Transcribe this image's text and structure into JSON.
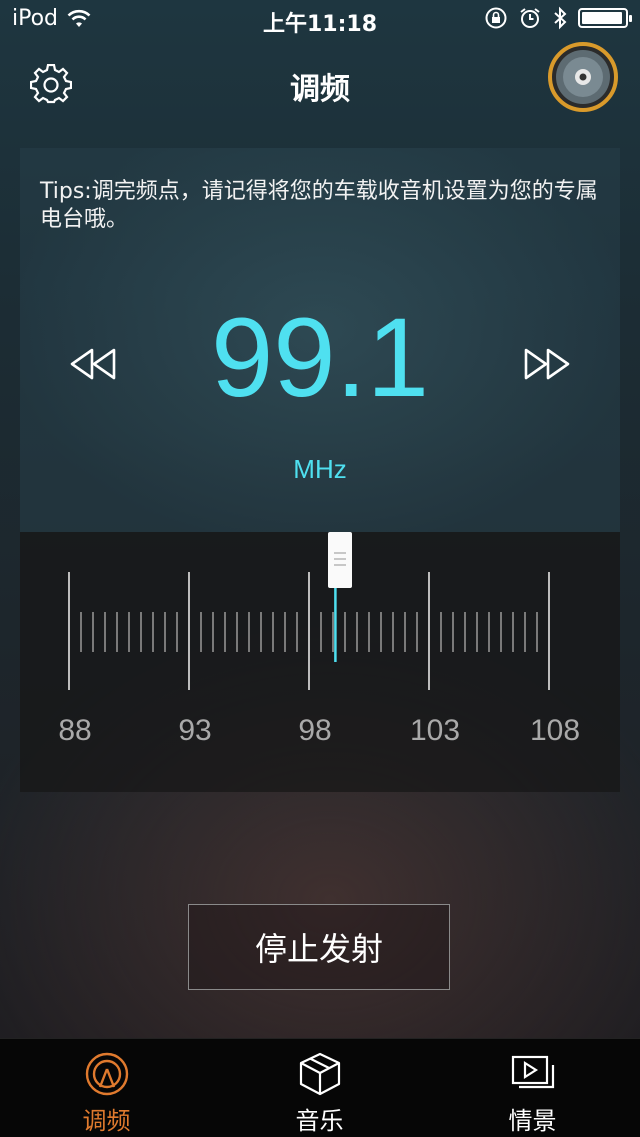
{
  "status_bar": {
    "device": "iPod",
    "time": "上午11:18",
    "icons": [
      "wifi-icon",
      "rotation-lock-icon",
      "alarm-icon",
      "bluetooth-icon",
      "battery-icon"
    ]
  },
  "nav": {
    "title": "调频",
    "left_icon": "gear-icon",
    "right_icon": "disc-icon"
  },
  "tuner": {
    "tips": "Tips:调完频点，请记得将您的车载收音机设置为您的专属电台哦。",
    "frequency": "99.1",
    "unit": "MHz",
    "current_value": 99.1,
    "range": [
      88,
      108
    ],
    "scale_labels": [
      "88",
      "93",
      "98",
      "103",
      "108"
    ]
  },
  "actions": {
    "stop_label": "停止发射"
  },
  "tabs": [
    {
      "label": "调频",
      "icon": "broadcast-icon",
      "active": true
    },
    {
      "label": "音乐",
      "icon": "box-icon",
      "active": false
    },
    {
      "label": "情景",
      "icon": "video-icon",
      "active": false
    }
  ],
  "colors": {
    "accent": "#4fe0f0",
    "tab_active": "#e07a2e",
    "tab_inactive": "#ffffff",
    "disc_ring": "#d99a2b"
  }
}
